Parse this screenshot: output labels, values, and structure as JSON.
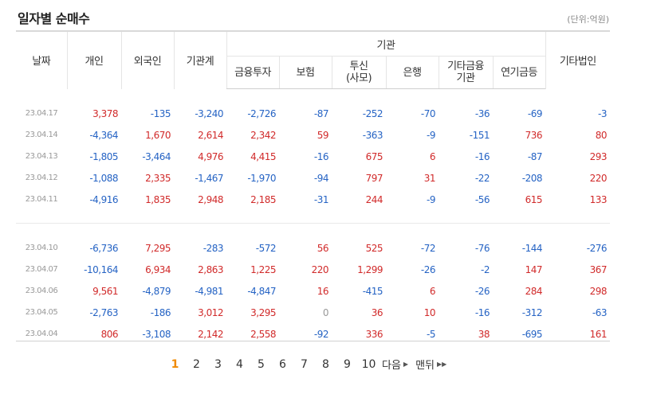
{
  "title": "일자별 순매수",
  "unit": "(단위:억원)",
  "headers": {
    "date": "날짜",
    "individual": "개인",
    "foreign": "외국인",
    "institution_total": "기관계",
    "institution_group": "기관",
    "finance": "금융투자",
    "insurance": "보험",
    "trust_line1": "투신",
    "trust_line2": "(사모)",
    "bank": "은행",
    "other_finance_line1": "기타금융",
    "other_finance_line2": "기관",
    "pension": "연기금등",
    "other_corp": "기타법인"
  },
  "rows": [
    {
      "date": "23.04.17",
      "v": [
        "3,378",
        "-135",
        "-3,240",
        "-2,726",
        "-87",
        "-252",
        "-70",
        "-36",
        "-69",
        "-3"
      ]
    },
    {
      "date": "23.04.14",
      "v": [
        "-4,364",
        "1,670",
        "2,614",
        "2,342",
        "59",
        "-363",
        "-9",
        "-151",
        "736",
        "80"
      ]
    },
    {
      "date": "23.04.13",
      "v": [
        "-1,805",
        "-3,464",
        "4,976",
        "4,415",
        "-16",
        "675",
        "6",
        "-16",
        "-87",
        "293"
      ]
    },
    {
      "date": "23.04.12",
      "v": [
        "-1,088",
        "2,335",
        "-1,467",
        "-1,970",
        "-94",
        "797",
        "31",
        "-22",
        "-208",
        "220"
      ]
    },
    {
      "date": "23.04.11",
      "v": [
        "-4,916",
        "1,835",
        "2,948",
        "2,185",
        "-31",
        "244",
        "-9",
        "-56",
        "615",
        "133"
      ]
    },
    {
      "date": "23.04.10",
      "v": [
        "-6,736",
        "7,295",
        "-283",
        "-572",
        "56",
        "525",
        "-72",
        "-76",
        "-144",
        "-276"
      ]
    },
    {
      "date": "23.04.07",
      "v": [
        "-10,164",
        "6,934",
        "2,863",
        "1,225",
        "220",
        "1,299",
        "-26",
        "-2",
        "147",
        "367"
      ]
    },
    {
      "date": "23.04.06",
      "v": [
        "9,561",
        "-4,879",
        "-4,981",
        "-4,847",
        "16",
        "-415",
        "6",
        "-26",
        "284",
        "298"
      ]
    },
    {
      "date": "23.04.05",
      "v": [
        "-2,763",
        "-186",
        "3,012",
        "3,295",
        "0",
        "36",
        "10",
        "-16",
        "-312",
        "-63"
      ]
    },
    {
      "date": "23.04.04",
      "v": [
        "806",
        "-3,108",
        "2,142",
        "2,558",
        "-92",
        "336",
        "-5",
        "38",
        "-695",
        "161"
      ]
    }
  ],
  "pager": {
    "pages": [
      "1",
      "2",
      "3",
      "4",
      "5",
      "6",
      "7",
      "8",
      "9",
      "10"
    ],
    "current": "1",
    "next": "다음",
    "last": "맨뒤"
  },
  "colors": {
    "positive": "#d12a2a",
    "negative": "#2563c4",
    "zero": "#999999",
    "current_page": "#f08a00"
  }
}
